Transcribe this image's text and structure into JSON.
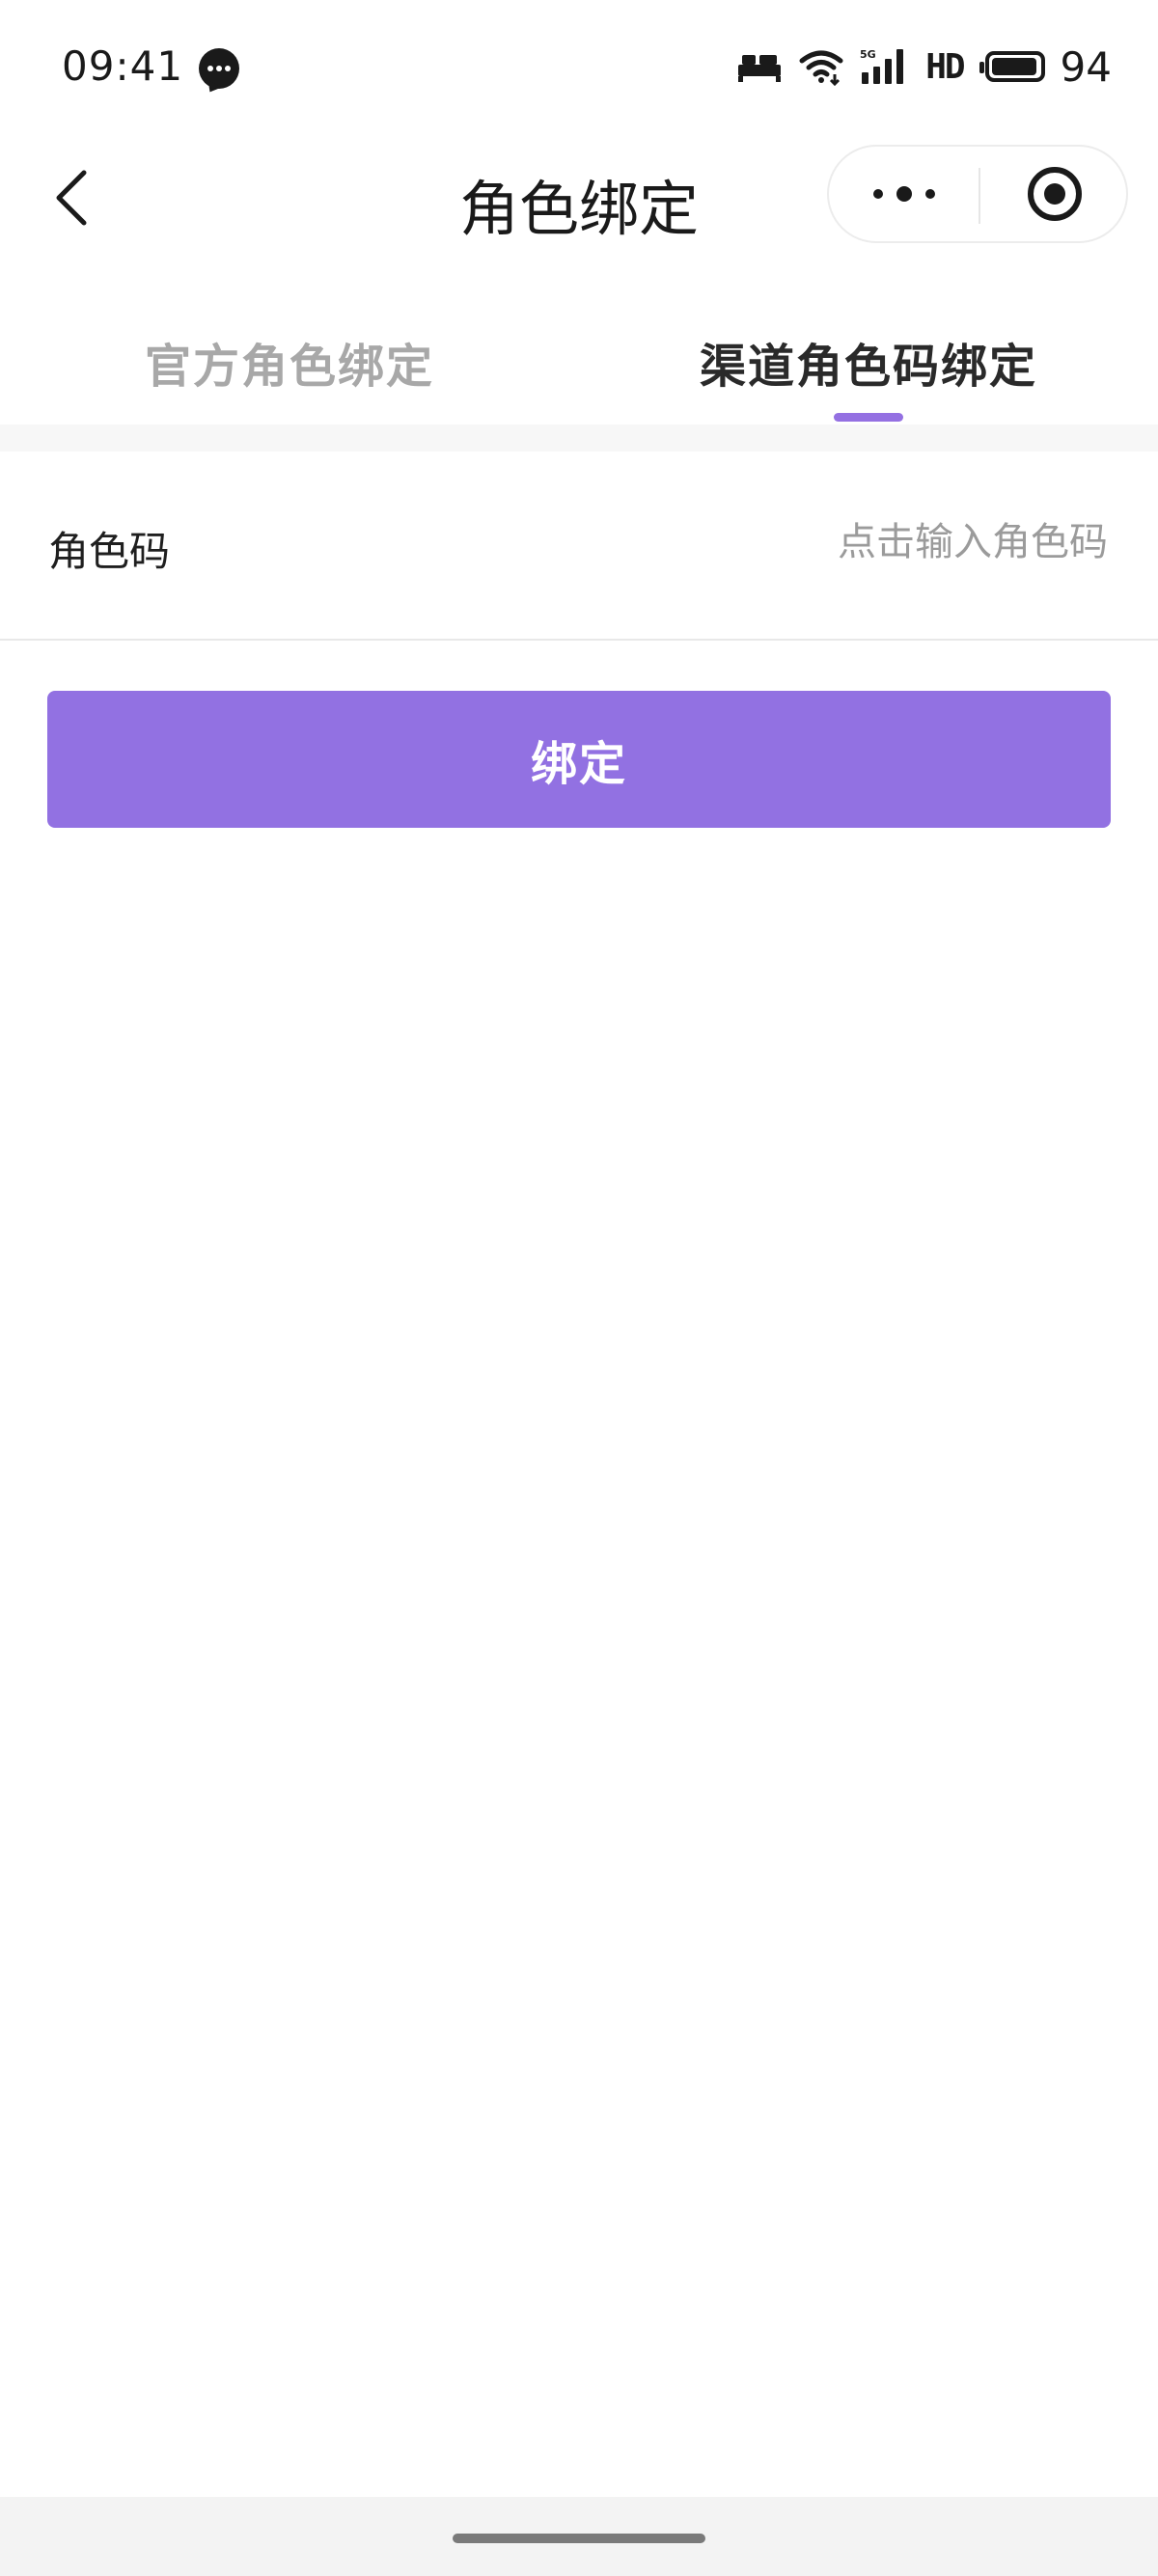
{
  "status_bar": {
    "time": "09:41",
    "network": "HD",
    "signal_label": "5G",
    "battery": "94",
    "icons": [
      "message-icon",
      "bed-icon",
      "wifi-icon",
      "signal-icon",
      "battery-icon"
    ]
  },
  "nav": {
    "title": "角色绑定",
    "back_icon": "chevron-left-icon",
    "more_icon": "more-dots-icon",
    "close_icon": "target-close-icon"
  },
  "tabs": [
    {
      "label": "官方角色绑定",
      "active": false
    },
    {
      "label": "渠道角色码绑定",
      "active": true
    }
  ],
  "form": {
    "role_code_label": "角色码",
    "role_code_value": "",
    "role_code_placeholder": "点击输入角色码"
  },
  "actions": {
    "bind_label": "绑定"
  },
  "colors": {
    "accent": "#9271e2",
    "inactive_tab": "#a8a8a8",
    "placeholder": "#9b9b9b"
  }
}
